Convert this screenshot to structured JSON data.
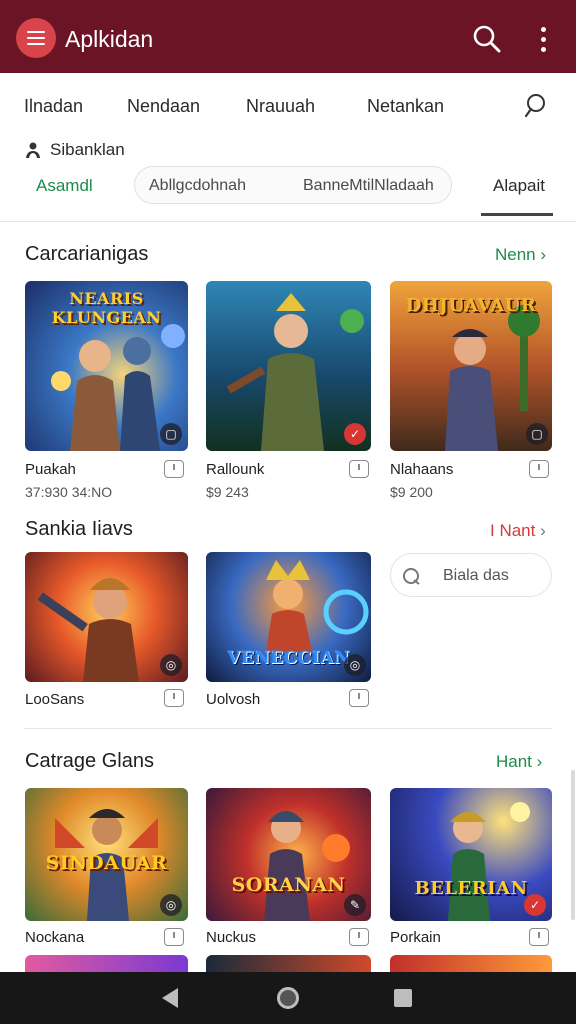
{
  "app": {
    "title": "Aplkidan",
    "accent": "#6b1426",
    "menu_icon": "hamburger-menu-icon",
    "search_icon": "search-icon",
    "more_icon": "more-vertical-icon"
  },
  "tabs": [
    "Ilnadan",
    "Nendaan",
    "Nrauuah",
    "Netankan"
  ],
  "subsection": {
    "label": "Sibanklan",
    "icon": "person-icon"
  },
  "filters": {
    "active": "Asamdl",
    "pill_left": "Abllgcdohnah",
    "pill_right": "BanneMtilNladaah",
    "right_tab": "Alapait"
  },
  "sections": [
    {
      "title": "Carcarianigas",
      "more": "Nenn",
      "cards": [
        {
          "art_title": "NEARIS KLUNGEAN",
          "name": "Puakah",
          "price": "37:930 34:NO",
          "badge": "dark"
        },
        {
          "art_title": "",
          "name": "Rallounk",
          "price": "$9 243",
          "badge": "red"
        },
        {
          "art_title": "DHJUAVAUR",
          "name": "Nlahaans",
          "price": "$9 200",
          "badge": "dark"
        }
      ]
    },
    {
      "title": "Sankia Iiavs",
      "more": "I Nant",
      "cards": [
        {
          "art_title": "",
          "name": "LooSans",
          "price": "",
          "badge": "dark"
        },
        {
          "art_title": "VENECCIAN",
          "name": "Uolvosh",
          "price": "",
          "badge": "dark"
        }
      ],
      "search": {
        "placeholder": "Biala das",
        "icon": "search-icon"
      }
    },
    {
      "title": "Catrage Glans",
      "more": "Hant",
      "cards": [
        {
          "art_title": "SINDAUAR",
          "name": "Nockana",
          "price": "",
          "badge": "dark"
        },
        {
          "art_title": "SORANAN",
          "name": "Nuckus",
          "price": "",
          "badge": "dark"
        },
        {
          "art_title": "BELERIAN",
          "name": "Porkain",
          "price": "",
          "badge": "red"
        }
      ]
    }
  ],
  "navbar": {
    "back_icon": "back-triangle-icon",
    "home_icon": "home-circle-icon",
    "recent_icon": "recents-square-icon"
  }
}
